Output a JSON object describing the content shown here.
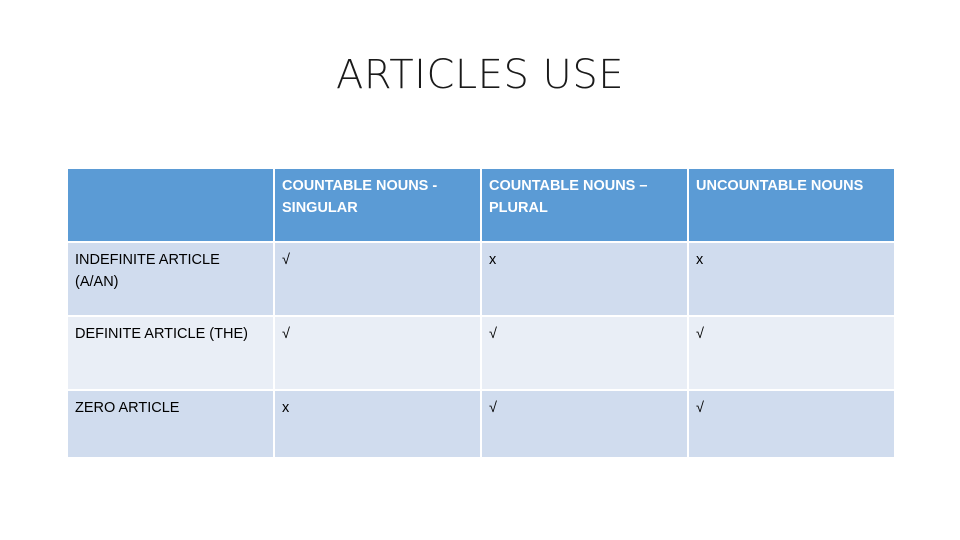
{
  "slide": {
    "title": "ARTICLES USE"
  },
  "table": {
    "columns": [
      "",
      "COUNTABLE NOUNS - SINGULAR",
      "COUNTABLE NOUNS – PLURAL",
      "UNCOUNTABLE NOUNS"
    ],
    "rows": [
      {
        "label": "INDEFINITE ARTICLE (A/AN)",
        "cells": [
          "√",
          "x",
          "x"
        ]
      },
      {
        "label": "DEFINITE ARTICLE (THE)",
        "cells": [
          "√",
          "√",
          "√"
        ]
      },
      {
        "label": "ZERO ARTICLE",
        "cells": [
          "x",
          "√",
          "√"
        ]
      }
    ],
    "colors": {
      "header": "#5b9bd5",
      "row_band_dark": "#d0dcee",
      "row_band_light": "#e9eef6"
    }
  }
}
